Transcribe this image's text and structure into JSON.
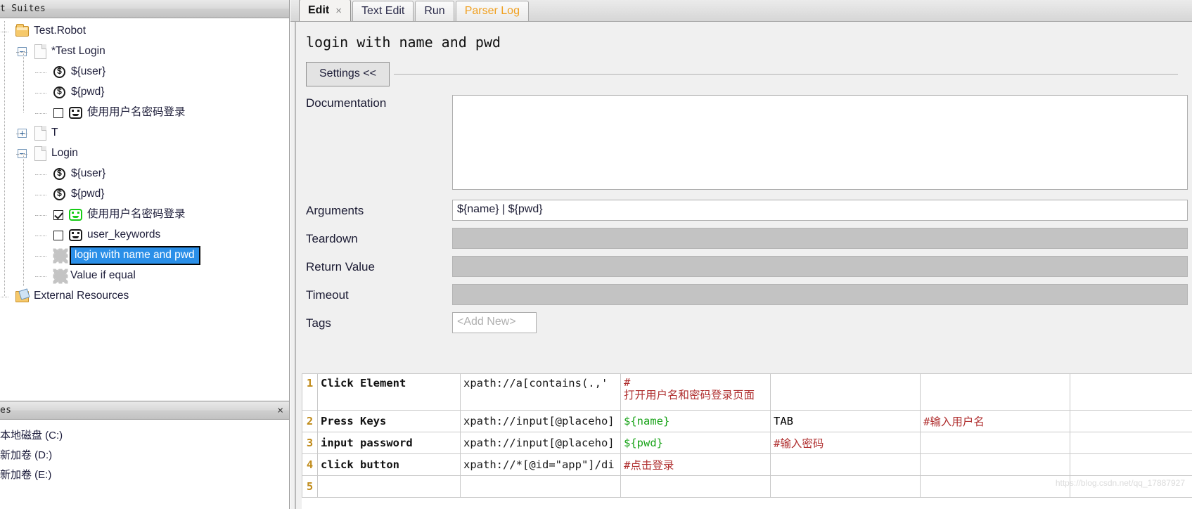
{
  "left_panel": {
    "header_title": "t Suites",
    "tree": [
      {
        "label": "Test.Robot",
        "icon": "folder-icon",
        "indent": 0,
        "expander": "none",
        "checkbox": "none"
      },
      {
        "label": "*Test Login",
        "icon": "file-icon",
        "indent": 1,
        "expander": "minus",
        "checkbox": "none"
      },
      {
        "label": "${user}",
        "icon": "variable-icon",
        "indent": 2,
        "expander": "none",
        "checkbox": "none"
      },
      {
        "label": "${pwd}",
        "icon": "variable-icon",
        "indent": 2,
        "expander": "none",
        "checkbox": "none"
      },
      {
        "label": "使用用户名密码登录",
        "icon": "keyword-icon",
        "indent": 2,
        "expander": "none",
        "checkbox": "unchecked"
      },
      {
        "label": "T",
        "icon": "file-icon",
        "indent": 1,
        "expander": "plus",
        "checkbox": "none"
      },
      {
        "label": "Login",
        "icon": "file-icon",
        "indent": 1,
        "expander": "minus",
        "checkbox": "none"
      },
      {
        "label": "${user}",
        "icon": "variable-icon",
        "indent": 2,
        "expander": "none",
        "checkbox": "none"
      },
      {
        "label": "${pwd}",
        "icon": "variable-icon",
        "indent": 2,
        "expander": "none",
        "checkbox": "none"
      },
      {
        "label": "使用用户名密码登录",
        "icon": "keyword-icon-green",
        "indent": 2,
        "expander": "none",
        "checkbox": "checked"
      },
      {
        "label": "user_keywords",
        "icon": "keyword-icon",
        "indent": 2,
        "expander": "none",
        "checkbox": "unchecked"
      },
      {
        "label": "login with name and pwd",
        "icon": "gear-icon",
        "indent": 2,
        "expander": "none",
        "checkbox": "none",
        "selected": true
      },
      {
        "label": "Value if equal",
        "icon": "gear-icon",
        "indent": 2,
        "expander": "none",
        "checkbox": "none"
      },
      {
        "label": "External Resources",
        "icon": "resource-icon",
        "indent": 0,
        "expander": "none",
        "checkbox": "none"
      }
    ]
  },
  "explorer_panel": {
    "header_title": "es",
    "close_label": "×",
    "drives": [
      {
        "label": "本地磁盘 (C:)"
      },
      {
        "label": "新加卷 (D:)"
      },
      {
        "label": "新加卷 (E:)"
      }
    ]
  },
  "tabs": [
    {
      "label": "Edit",
      "active": true,
      "closable": true,
      "close_label": "×",
      "accent": false
    },
    {
      "label": "Text Edit",
      "active": false,
      "closable": false,
      "accent": false
    },
    {
      "label": "Run",
      "active": false,
      "closable": false,
      "accent": false
    },
    {
      "label": "Parser Log",
      "active": false,
      "closable": false,
      "accent": true
    }
  ],
  "editor": {
    "keyword_title": "login with name and pwd",
    "settings_button": "Settings <<",
    "fields": {
      "documentation_label": "Documentation",
      "documentation_value": "",
      "arguments_label": "Arguments",
      "arguments_value": "${name} | ${pwd}",
      "teardown_label": "Teardown",
      "teardown_value": "",
      "return_value_label": "Return Value",
      "return_value_value": "",
      "timeout_label": "Timeout",
      "timeout_value": "",
      "tags_label": "Tags",
      "tags_placeholder": "<Add New>"
    }
  },
  "grid": {
    "rows": [
      {
        "num": "1",
        "keyword": "Click Element",
        "arg1": "xpath://a[contains(.,'",
        "arg2_prefix": "#",
        "arg2_main": "打开用户名和密码登录页面",
        "arg3": "",
        "arg4": "",
        "arg5": "",
        "tall": true
      },
      {
        "num": "2",
        "keyword": "Press Keys",
        "arg1": "xpath://input[@placeho]",
        "arg2_prefix": "",
        "arg2_main": "${name}",
        "arg3": "TAB",
        "arg4": "#输入用户名",
        "arg5": "",
        "tall": false
      },
      {
        "num": "3",
        "keyword": "input password",
        "arg1": "xpath://input[@placeho]",
        "arg2_prefix": "",
        "arg2_main": "${pwd}",
        "arg3": "#输入密码",
        "arg4": "",
        "arg5": "",
        "tall": false
      },
      {
        "num": "4",
        "keyword": "click button",
        "arg1": "xpath://*[@id=\"app\"]/di",
        "arg2_prefix": "",
        "arg2_main": "#点击登录",
        "arg3": "",
        "arg4": "",
        "arg5": "",
        "tall": false
      },
      {
        "num": "5",
        "keyword": "",
        "arg1": "",
        "arg2_prefix": "",
        "arg2_main": "",
        "arg3": "",
        "arg4": "",
        "arg5": "",
        "tall": false
      }
    ]
  },
  "watermark": "https://blog.csdn.net/qq_17887927"
}
